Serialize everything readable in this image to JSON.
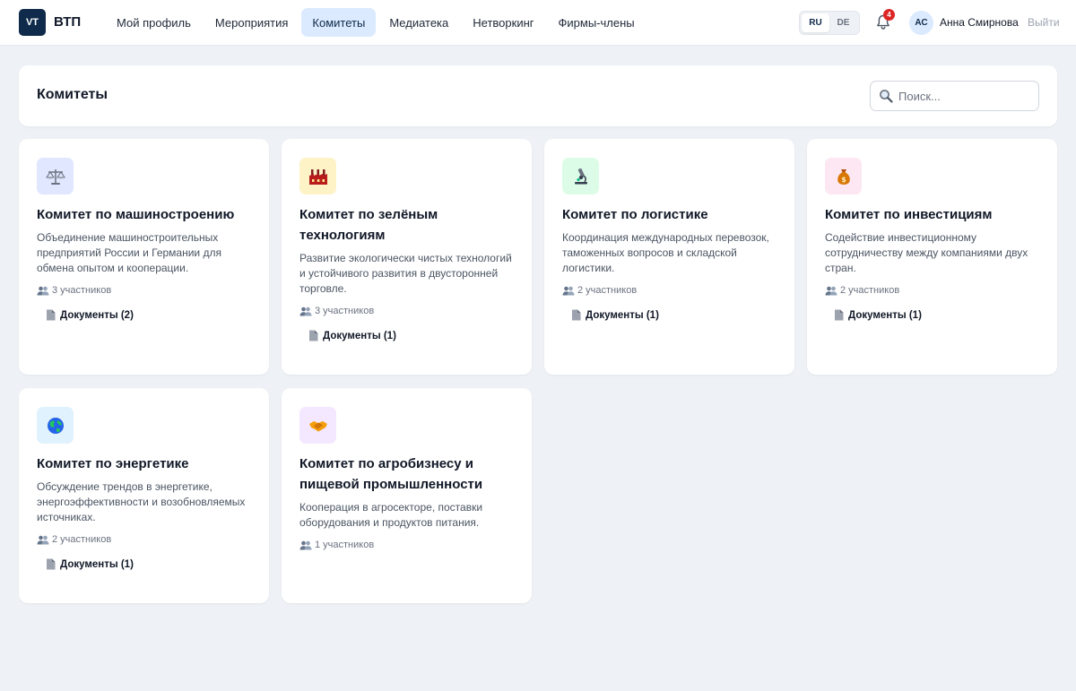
{
  "header": {
    "logo_badge": "VT",
    "logo_text": "ВТП",
    "nav": [
      {
        "label": "Мой профиль",
        "active": false
      },
      {
        "label": "Мероприятия",
        "active": false
      },
      {
        "label": "Комитеты",
        "active": true
      },
      {
        "label": "Медиатека",
        "active": false
      },
      {
        "label": "Нетворкинг",
        "active": false
      },
      {
        "label": "Фирмы-члены",
        "active": false
      }
    ],
    "languages": [
      {
        "label": "RU",
        "active": true
      },
      {
        "label": "DE",
        "active": false
      }
    ],
    "notifications_count": "4",
    "user_initials": "АС",
    "user_name": "Анна Смирнова",
    "logout_label": "Выйти"
  },
  "page": {
    "title": "Комитеты",
    "search_placeholder": "Поиск..."
  },
  "committees": [
    {
      "icon": "scales-icon",
      "title": "Комитет по машиностроению",
      "description": "Объединение машиностроительных предприятий России и Германии для обмена опытом и кооперации.",
      "members": "3 участников",
      "documents": "Документы (2)"
    },
    {
      "icon": "factory-icon",
      "title": "Комитет по зелёным технологиям",
      "description": "Развитие экологически чистых технологий и устойчивого развития в двусторонней торговле.",
      "members": "3 участников",
      "documents": "Документы (1)"
    },
    {
      "icon": "microscope-icon",
      "title": "Комитет по логистике",
      "description": "Координация международных перевозок, таможенных вопросов и складской логистики.",
      "members": "2 участников",
      "documents": "Документы (1)"
    },
    {
      "icon": "money-bag-icon",
      "title": "Комитет по инвестициям",
      "description": "Содействие инвестиционному сотрудничеству между компаниями двух стран.",
      "members": "2 участников",
      "documents": "Документы (1)"
    },
    {
      "icon": "globe-icon",
      "title": "Комитет по энергетике",
      "description": "Обсуждение трендов в энергетике, энергоэффективности и возобновляемых источниках.",
      "members": "2 участников",
      "documents": "Документы (1)"
    },
    {
      "icon": "handshake-icon",
      "title": "Комитет по агробизнесу и пищевой промышленности",
      "description": "Кооперация в агросекторе, поставки оборудования и продуктов питания.",
      "members": "1 участников",
      "documents": ""
    }
  ],
  "colors": {
    "accent": "#0f2a4a",
    "nav_active_bg": "#dbeafe",
    "badge": "#dc2626",
    "background": "#eef1f5"
  }
}
